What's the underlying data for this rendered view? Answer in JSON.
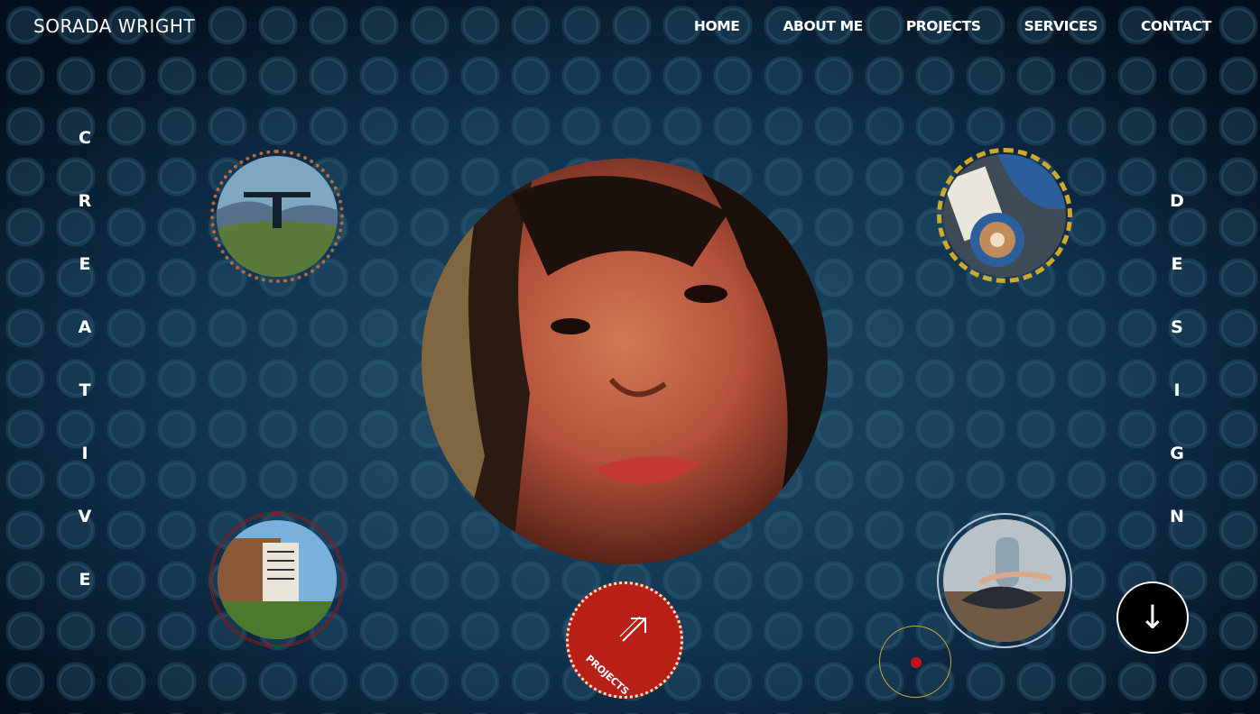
{
  "brand": {
    "name": "SORADA WRIGHT"
  },
  "nav": {
    "items": [
      {
        "label": "HOME"
      },
      {
        "label": "ABOUT ME"
      },
      {
        "label": "PROJECTS"
      },
      {
        "label": "SERVICES"
      },
      {
        "label": "CONTACT"
      }
    ]
  },
  "side_left": {
    "letters": [
      "C",
      "R",
      "E",
      "A",
      "T",
      "I",
      "V",
      "E"
    ]
  },
  "side_right": {
    "letters": [
      "D",
      "E",
      "S",
      "I",
      "G",
      "N"
    ]
  },
  "projects_button": {
    "label": "PROJECTS",
    "icon": "arrow-up-right-icon"
  },
  "scroll_button": {
    "icon": "arrow-down-icon",
    "glyph": "↓"
  },
  "colors": {
    "background": "#0b2740",
    "accent_red": "#b81f17",
    "accent_gold": "#c9a640"
  }
}
